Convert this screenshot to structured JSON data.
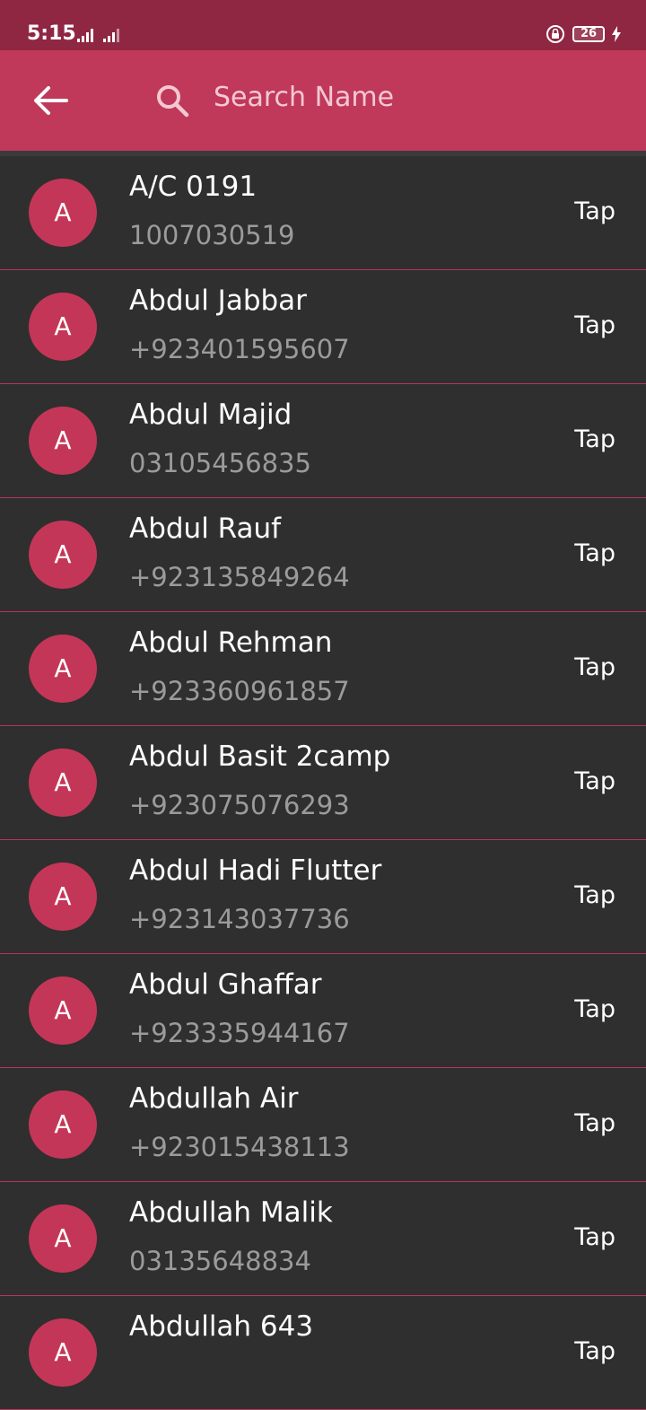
{
  "status_bar": {
    "time": "5:15",
    "battery": "26"
  },
  "app_bar": {
    "search_placeholder": "Search Name"
  },
  "contacts": [
    {
      "initial": "A",
      "name": "A/C 0191",
      "phone": "1007030519",
      "action": "Tap"
    },
    {
      "initial": "A",
      "name": "Abdul Jabbar",
      "phone": "+923401595607",
      "action": "Tap"
    },
    {
      "initial": "A",
      "name": "Abdul Majid",
      "phone": "03105456835",
      "action": "Tap"
    },
    {
      "initial": "A",
      "name": "Abdul Rauf",
      "phone": "+923135849264",
      "action": "Tap"
    },
    {
      "initial": "A",
      "name": "Abdul Rehman",
      "phone": "+923360961857",
      "action": "Tap"
    },
    {
      "initial": "A",
      "name": "Abdul Basit 2camp",
      "phone": "+923075076293",
      "action": "Tap"
    },
    {
      "initial": "A",
      "name": "Abdul Hadi Flutter",
      "phone": "+923143037736",
      "action": "Tap"
    },
    {
      "initial": "A",
      "name": "Abdul Ghaffar",
      "phone": "+923335944167",
      "action": "Tap"
    },
    {
      "initial": "A",
      "name": "Abdullah Air",
      "phone": "+923015438113",
      "action": "Tap"
    },
    {
      "initial": "A",
      "name": "Abdullah Malik",
      "phone": "03135648834",
      "action": "Tap"
    },
    {
      "initial": "A",
      "name": "Abdullah 643",
      "phone": "",
      "action": "Tap"
    }
  ],
  "colors": {
    "status_bar": "#8f2743",
    "app_bar": "#c0385a",
    "avatar": "#c43657",
    "background": "#2f2f2f",
    "divider": "#b8355a"
  }
}
